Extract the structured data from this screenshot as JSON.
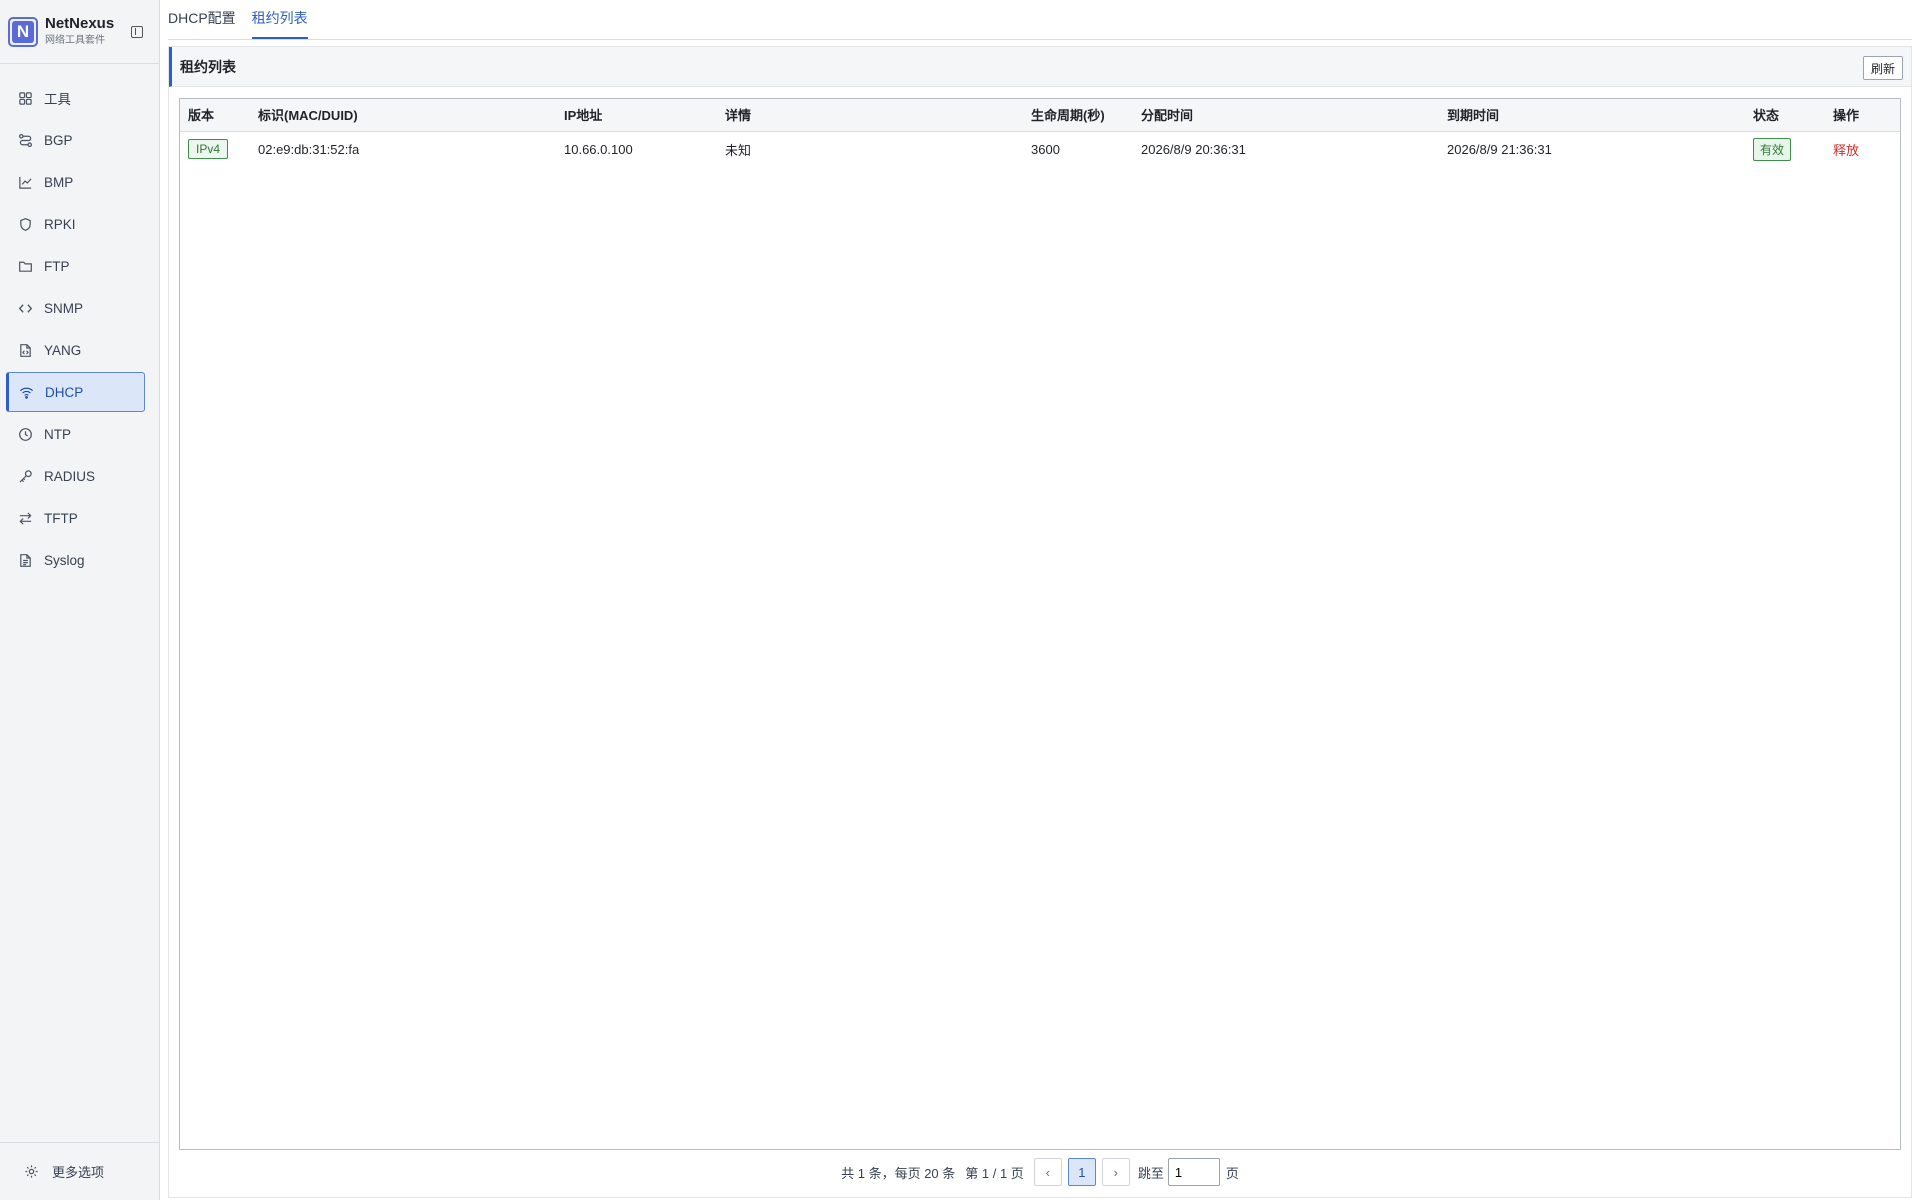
{
  "brand": {
    "name": "NetNexus",
    "subtitle": "网络工具套件",
    "logo_letter": "N"
  },
  "sidebar": {
    "items": [
      {
        "label": "工具",
        "icon": "grid-icon",
        "active": false
      },
      {
        "label": "BGP",
        "icon": "route-icon",
        "active": false
      },
      {
        "label": "BMP",
        "icon": "chart-icon",
        "active": false
      },
      {
        "label": "RPKI",
        "icon": "shield-icon",
        "active": false
      },
      {
        "label": "FTP",
        "icon": "folder-icon",
        "active": false
      },
      {
        "label": "SNMP",
        "icon": "code-icon",
        "active": false
      },
      {
        "label": "YANG",
        "icon": "file-code-icon",
        "active": false
      },
      {
        "label": "DHCP",
        "icon": "wifi-icon",
        "active": true
      },
      {
        "label": "NTP",
        "icon": "clock-icon",
        "active": false
      },
      {
        "label": "RADIUS",
        "icon": "key-icon",
        "active": false
      },
      {
        "label": "TFTP",
        "icon": "arrows-swap-icon",
        "active": false
      },
      {
        "label": "Syslog",
        "icon": "file-text-icon",
        "active": false
      }
    ],
    "footer_label": "更多选项"
  },
  "tabs": [
    {
      "label": "DHCP配置",
      "active": false
    },
    {
      "label": "租约列表",
      "active": true
    }
  ],
  "panel": {
    "title": "租约列表",
    "refresh_label": "刷新"
  },
  "table": {
    "columns": [
      "版本",
      "标识(MAC/DUID)",
      "IP地址",
      "详情",
      "生命周期(秒)",
      "分配时间",
      "到期时间",
      "状态",
      "操作"
    ],
    "rows": [
      {
        "version": "IPv4",
        "identifier": "02:e9:db:31:52:fa",
        "ip": "10.66.0.100",
        "detail": "未知",
        "lifetime": "3600",
        "assigned": "2026/8/9 20:36:31",
        "expires": "2026/8/9 21:36:31",
        "status": "有效",
        "action": "释放"
      }
    ]
  },
  "pagination": {
    "summary": "共 1 条，每页 20 条",
    "page_info": "第 1 / 1 页",
    "prev": "‹",
    "next": "›",
    "current_page": "1",
    "jump_label": "跳至",
    "jump_value": "1",
    "jump_suffix": "页"
  },
  "colors": {
    "accent": "#2d5fc4",
    "success": "#2f7a3b",
    "danger": "#d0312d"
  }
}
